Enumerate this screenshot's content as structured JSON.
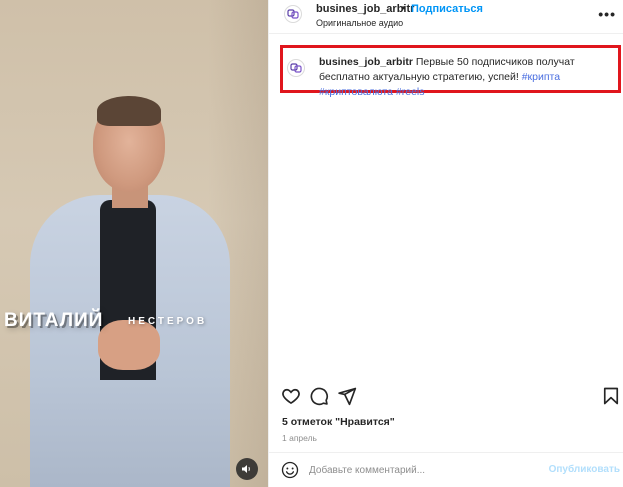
{
  "video": {
    "overlay_name": "ВИТАЛИЙ",
    "overlay_surname": "НЕСТЕРОВ",
    "audio_button_icon": "speaker-icon"
  },
  "header": {
    "username": "busines_job_arbitr",
    "separator": "•",
    "follow_label": "Подписаться",
    "audio_label": "Оригинальное аудио",
    "more_label": "•••"
  },
  "caption": {
    "username": "busines_job_arbitr",
    "text": "Первые 50 подписчиков получат бесплатно актуальную стратегию, успей!",
    "hashtags": [
      "#крипта",
      "#криптовалюта",
      "#reels"
    ]
  },
  "actions": {
    "like_icon": "heart-icon",
    "comment_icon": "comment-icon",
    "share_icon": "send-icon",
    "save_icon": "bookmark-icon"
  },
  "likes_text": "5 отметок \"Нравится\"",
  "date_text": "1 апрель",
  "comment": {
    "placeholder": "Добавьте комментарий...",
    "publish_label": "Опубликовать",
    "emoji_icon": "emoji-icon"
  },
  "colors": {
    "accent": "#0095f6",
    "highlight_border": "#e0161d",
    "hashtag": "#4a6ee0"
  }
}
